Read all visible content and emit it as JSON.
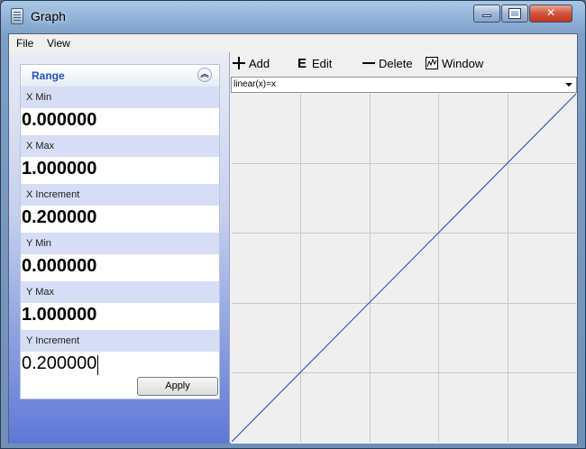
{
  "window": {
    "title": "Graph",
    "controls": {
      "minimize": "–",
      "maximize": "□",
      "close": "✕"
    }
  },
  "menu": {
    "items": [
      "File",
      "View"
    ]
  },
  "range_panel": {
    "title": "Range",
    "collapse_icon": "chevron-up-double",
    "fields": [
      {
        "label": "X Min",
        "value": "0.000000"
      },
      {
        "label": "X Max",
        "value": "1.000000"
      },
      {
        "label": "X Increment",
        "value": "0.200000"
      },
      {
        "label": "Y Min",
        "value": "0.000000"
      },
      {
        "label": "Y Max",
        "value": "1.000000"
      },
      {
        "label": "Y Increment",
        "value": "0.200000"
      }
    ],
    "apply_label": "Apply"
  },
  "toolbar": {
    "add_label": "Add",
    "edit_label": "Edit",
    "delete_label": "Delete",
    "window_label": "Window",
    "edit_icon_glyph": "E"
  },
  "function_select": {
    "selected": "linear(x)=x"
  },
  "plot": {
    "grid": true,
    "line_color": "#1f3fbf",
    "grid_color": "#c8c8c8",
    "x_range": [
      0,
      1
    ],
    "y_range": [
      0,
      1
    ],
    "x_increment": 0.2,
    "y_increment": 0.2,
    "points": [
      [
        0,
        0
      ],
      [
        1,
        1
      ]
    ]
  }
}
